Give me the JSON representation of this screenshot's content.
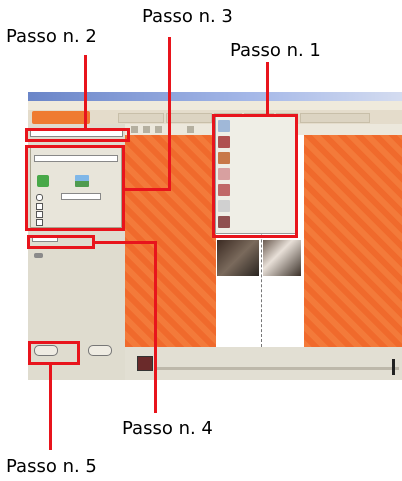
{
  "annotations": {
    "step1": "Passo n. 1",
    "step2": "Passo n. 2",
    "step3": "Passo n. 3",
    "step4": "Passo n. 4",
    "step5": "Passo n. 5"
  },
  "colors": {
    "annotation_red": "#e8141c",
    "canvas_orange": "#f06a2c",
    "panel_bg": "#dfdccf"
  },
  "icons": {
    "window_controls": [
      "minimize-icon",
      "maximize-icon",
      "close-icon"
    ],
    "popup_items": [
      "layout-icon",
      "frame-icon",
      "photo-icon",
      "clipart-icon",
      "background-icon",
      "text-icon",
      "page-icon"
    ]
  }
}
